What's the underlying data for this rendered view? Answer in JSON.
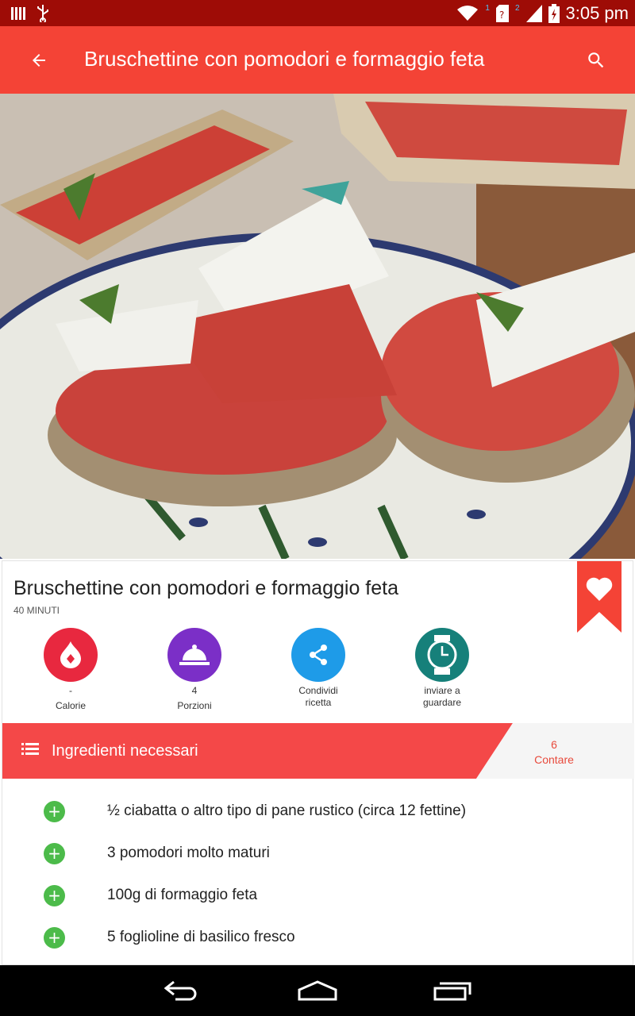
{
  "status_bar": {
    "time": "3:05 pm",
    "icons": [
      "sim-icon",
      "usb-icon",
      "wifi-icon",
      "no-sim-icon",
      "signal-icon",
      "battery-charging-icon"
    ],
    "badges": [
      "1",
      "2"
    ]
  },
  "app_bar": {
    "title": "Bruschettine con pomodori e formaggio feta",
    "back_icon": "arrow-back-icon",
    "search_icon": "search-icon",
    "color": "#f44336"
  },
  "recipe": {
    "title": "Bruschettine con pomodori e formaggio feta",
    "time": "40 MINUTI",
    "actions": [
      {
        "value": "-",
        "label": "Calorie",
        "icon": "flame-icon",
        "color": "#e8283f"
      },
      {
        "value": "4",
        "label": "Porzioni",
        "icon": "serving-dish-icon",
        "color": "#7b2fc7"
      },
      {
        "value": "",
        "label": "Condividi ricetta",
        "icon": "share-icon",
        "color": "#1e9be8"
      },
      {
        "value": "",
        "label": "inviare a guardare",
        "icon": "watch-icon",
        "color": "#16807a"
      }
    ]
  },
  "ingredients": {
    "header": "Ingredienti necessari",
    "count_value": "6",
    "count_label": "Contare",
    "items": [
      "½ ciabatta o altro tipo di pane rustico (circa 12 fettine)",
      "3 pomodori molto maturi",
      "100g di formaggio feta",
      "5 foglioline di basilico fresco"
    ]
  },
  "nav_bar": {
    "icons": [
      "back-nav-icon",
      "home-nav-icon",
      "recents-nav-icon"
    ]
  }
}
